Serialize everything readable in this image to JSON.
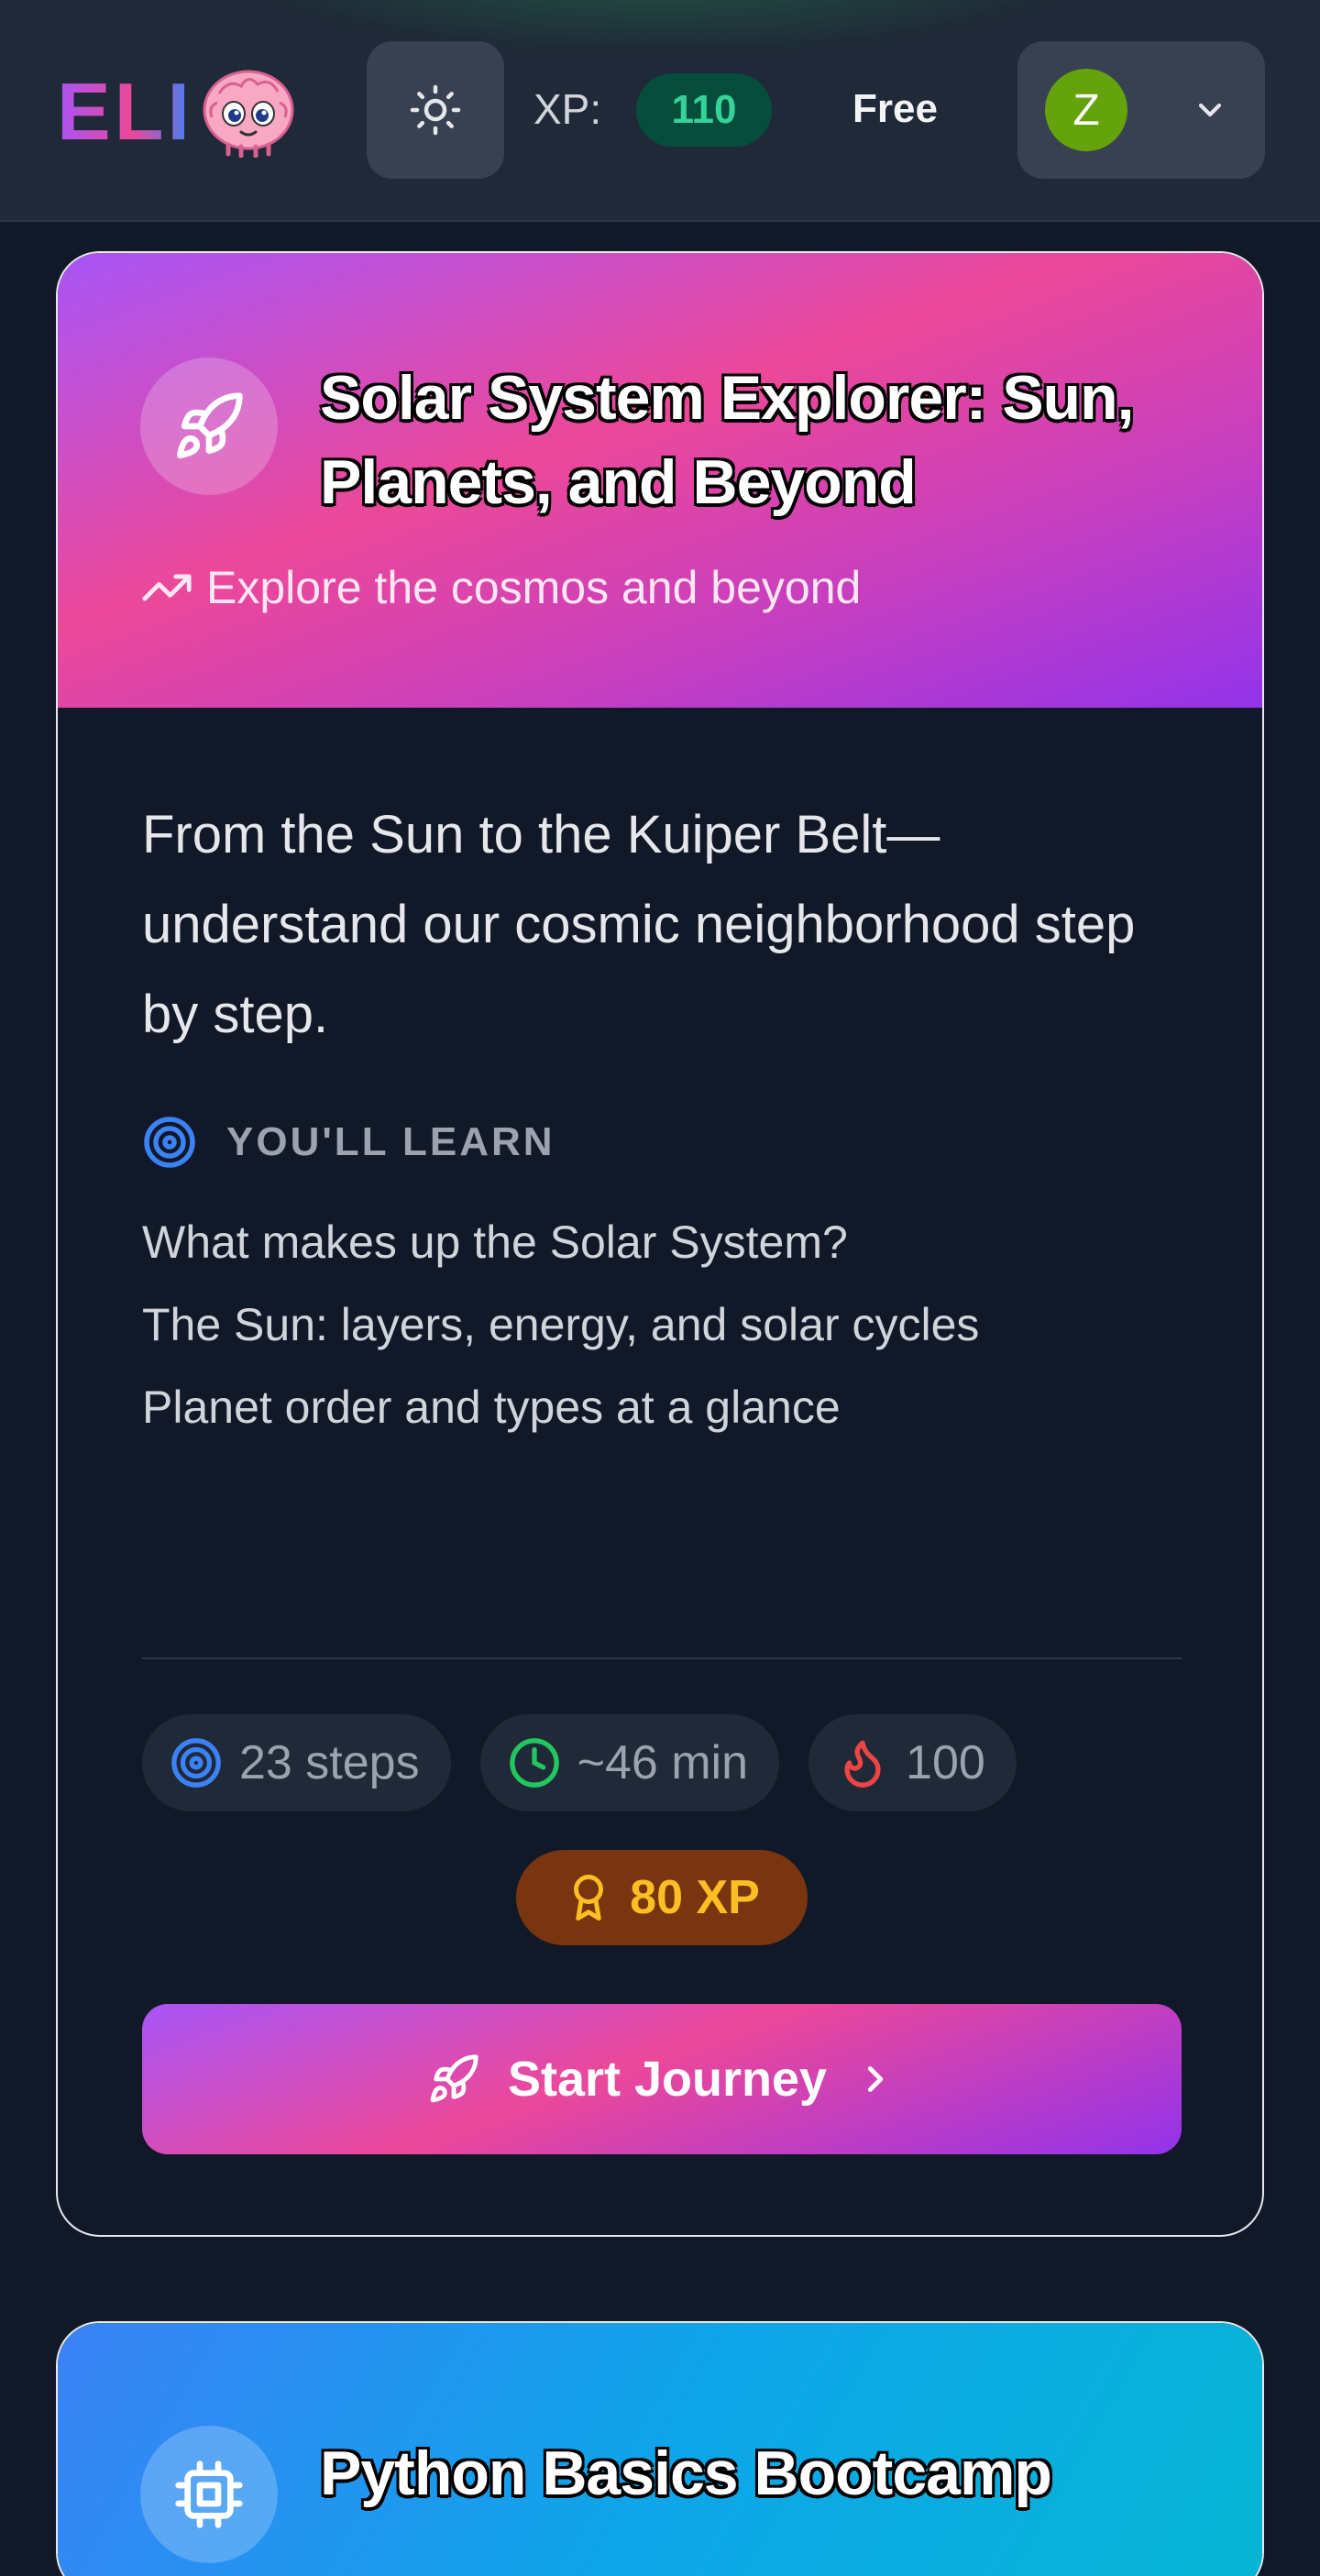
{
  "header": {
    "logo_text": "ELI",
    "xp_label": "XP:",
    "xp_value": "110",
    "plan": "Free",
    "avatar_initial": "Z"
  },
  "courses": [
    {
      "title": "Solar System Explorer: Sun, Planets, and Beyond",
      "subtitle": "Explore the cosmos and beyond",
      "icon": "rocket-icon",
      "description": "From the Sun to the Kuiper Belt—understand our cosmic neighborhood step by step.",
      "learn_heading": "YOU'LL LEARN",
      "learn_items": [
        "What makes up the Solar System?",
        "The Sun: layers, energy, and solar cycles",
        "Planet order and types at a glance"
      ],
      "stats": {
        "steps": "23 steps",
        "time": "~46 min",
        "streak": "100"
      },
      "xp_reward": "80 XP",
      "cta": "Start Journey"
    },
    {
      "title": "Python Basics Bootcamp",
      "icon": "chip-icon"
    }
  ],
  "colors": {
    "background": "#111827",
    "header": "#1f2937",
    "xp_green": "#34d399",
    "reward_gold": "#fbbf24",
    "accent_pink": "#ec4899",
    "accent_purple": "#a855f7",
    "accent_blue": "#3b82f6"
  }
}
